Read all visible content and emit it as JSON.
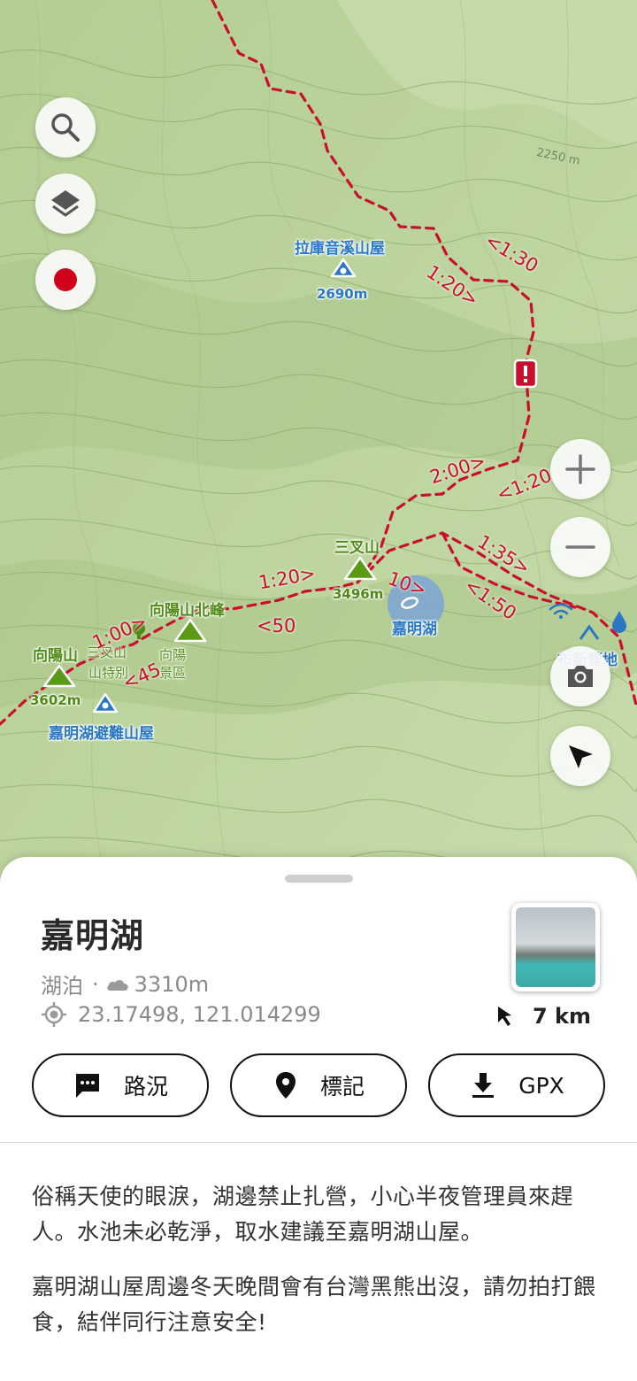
{
  "map": {
    "huts": [
      {
        "name": "拉庫音溪山屋",
        "elevation": "2690m"
      },
      {
        "name": "嘉明湖避難山屋"
      }
    ],
    "peaks": [
      {
        "name": "三叉山",
        "elevation": "3496m"
      },
      {
        "name": "向陽山北峰"
      },
      {
        "name": "向陽山",
        "elevation": "3602m"
      }
    ],
    "lake_label": "嘉明湖",
    "campsite_label": "布新營地",
    "contour_label": "2250 m",
    "area_labels": [
      "三叉山",
      "向陽",
      "山特別",
      "景區"
    ],
    "trail_times": [
      "<1:30",
      "1:20>",
      "2:00>",
      "<1:20",
      "1:35>",
      "<1:50",
      "1:20>",
      "<50",
      "10>",
      "1:00>",
      "<45"
    ],
    "colors": {
      "trail": "#c8102e",
      "hut": "#2a77c4",
      "peak": "#5a9a16",
      "record": "#d0021b"
    },
    "controls": [
      "search-icon",
      "layers-icon",
      "record-icon",
      "zoom-in-icon",
      "zoom-out-icon",
      "camera-icon",
      "locate-icon"
    ]
  },
  "place": {
    "title": "嘉明湖",
    "category": "湖泊",
    "elevation": "3310m",
    "coordinates": "23.17498, 121.014299",
    "distance": "7 km"
  },
  "actions": [
    {
      "label": "路況",
      "icon": "chat-icon"
    },
    {
      "label": "標記",
      "icon": "pin-icon"
    },
    {
      "label": "GPX",
      "icon": "download-icon"
    }
  ],
  "description": [
    "俗稱天使的眼淚，湖邊禁止扎營，小心半夜管理員來趕人。水池未必乾淨，取水建議至嘉明湖山屋。",
    "嘉明湖山屋周邊冬天晚間會有台灣黑熊出沒，請勿拍打餵食，結伴同行注意安全!"
  ]
}
